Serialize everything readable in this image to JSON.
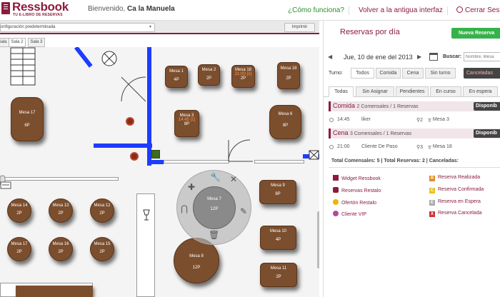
{
  "header": {
    "logo": "Ressbook",
    "tagline": "TU E-LIBRO DE RESERVAS",
    "welcome_prefix": "Bienvenido,",
    "welcome_name": "Ca la Manuela",
    "how_link": "¿Cómo funciona?",
    "old_link": "Volver a la antigua interfaz",
    "logout": "Cerrar Sesi"
  },
  "toolbar": {
    "config_value": "onfiguración predeterminada",
    "print_label": "Imprimir"
  },
  "rooms": [
    "Sala 1",
    "Sala 2",
    "Sala 3"
  ],
  "tables": [
    {
      "name": "Mesa 1",
      "pax": "4P",
      "res": ""
    },
    {
      "name": "Mesa 2",
      "pax": "2P",
      "res": ""
    },
    {
      "name": "Mesa 18",
      "pax": "2P",
      "res": "21:00 [1]"
    },
    {
      "name": "Mesa 18",
      "pax": "2P",
      "res": ""
    },
    {
      "name": "Mesa 3",
      "pax": "8P",
      "res": "14:45 [1]"
    },
    {
      "name": "Mesa 6",
      "pax": "8P",
      "res": ""
    },
    {
      "name": "Mesa 17",
      "pax": "6P",
      "res": ""
    },
    {
      "name": "Mesa 9",
      "pax": "8P",
      "res": ""
    },
    {
      "name": "Mesa 14",
      "pax": "2P",
      "res": ""
    },
    {
      "name": "Mesa 13",
      "pax": "2P",
      "res": ""
    },
    {
      "name": "Mesa 12",
      "pax": "2P",
      "res": ""
    },
    {
      "name": "Mesa 10",
      "pax": "4P",
      "res": ""
    },
    {
      "name": "Mesa 17",
      "pax": "2P",
      "res": ""
    },
    {
      "name": "Mesa 16",
      "pax": "2P",
      "res": ""
    },
    {
      "name": "Mesa 15",
      "pax": "2P",
      "res": ""
    },
    {
      "name": "Mesa 8",
      "pax": "12P",
      "res": ""
    },
    {
      "name": "Mesa 11",
      "pax": "2P",
      "res": ""
    }
  ],
  "wheel": {
    "name": "Mesa 7",
    "pax": "12P"
  },
  "panel": {
    "title": "Reservas por día",
    "new_button": "Nueva Reserva",
    "date": "Jue, 10 de ene del 2013",
    "search_label": "Buscar:",
    "search_placeholder": "Nombre, Mesa",
    "turno_label": "Turno:",
    "turnos": [
      "Todos",
      "Comida",
      "Cena",
      "Sin turno"
    ],
    "cancel_button": "Canceladas",
    "filters": [
      "Todas",
      "Sin Asignar",
      "Pendientes",
      "En curso",
      "En espera"
    ],
    "services": [
      {
        "name": "Comida",
        "counts": "2 Comensales / 1 Reservas",
        "avail": "Disponib",
        "rows": [
          {
            "time": "14:45",
            "name": "liker",
            "pax": "2",
            "table": "Mesa 3"
          }
        ]
      },
      {
        "name": "Cena",
        "counts": "3 Comensales / 1 Reservas",
        "avail": "Disponib",
        "rows": [
          {
            "time": "21:00",
            "name": "Cliente De Paso",
            "pax": "3",
            "table": "Mesa 18"
          }
        ]
      }
    ],
    "totals": "Total Comensales: 5 | Total Reservas: 2 | Canceladas:",
    "legend": [
      {
        "label": "Widget Ressbook",
        "icon": "widget-icon",
        "color": "#8b1c3e"
      },
      {
        "label": "Reservas Restalo",
        "icon": "restalo-icon",
        "color": "#8b1c3e"
      },
      {
        "label": "Ofertón Restalo",
        "icon": "oferton-icon",
        "color": "#f0b400"
      },
      {
        "label": "Cliente VIP",
        "icon": "vip-icon",
        "color": "#b04aa0"
      },
      {
        "label": "Reserva Realizada",
        "icon": "R",
        "color": "#e08a2b"
      },
      {
        "label": "Reserva Confirmada",
        "icon": "C",
        "color": "#e8c21f"
      },
      {
        "label": "Reserva en Espera",
        "icon": "E",
        "color": "#aaaaaa"
      },
      {
        "label": "Reserva Cancelada",
        "icon": "X",
        "color": "#cc3333"
      }
    ]
  },
  "colors": {
    "brand": "#8b1c3e",
    "wall": "#1e3cff",
    "table": "#7b4e2e",
    "new_button": "#36b24a"
  }
}
